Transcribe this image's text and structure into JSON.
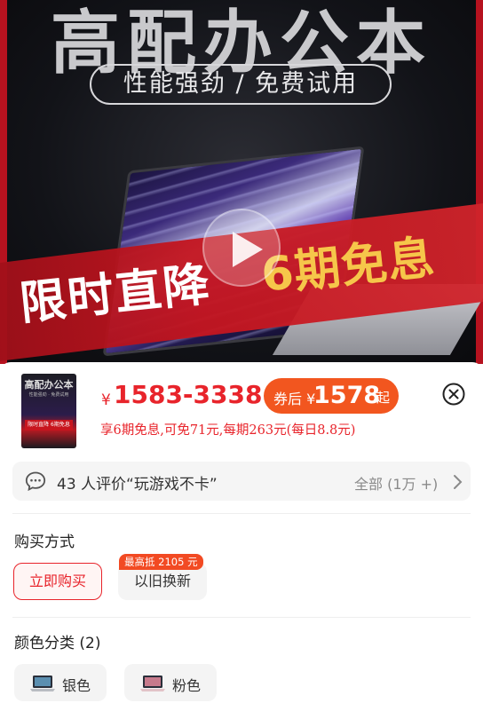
{
  "banner": {
    "title": "高配办公本",
    "subtitle": "性能强劲 / 免费试用",
    "promo_left": "限时直降",
    "promo_right": "6期免息",
    "play_icon": "play-icon"
  },
  "product": {
    "thumb_title": "高配办公本",
    "thumb_sub": "性能强劲 · 免费试用",
    "thumb_strip": "限时直降 6期免息",
    "currency": "¥",
    "price_range": "1583-3338",
    "coupon_prefix": "券后 ¥",
    "coupon_price": "1578",
    "coupon_suffix": "起",
    "installment": "享6期免息,可免71元,每期263元(每日8.8元)"
  },
  "review": {
    "text": "43 人评价“玩游戏不卡”",
    "all": "全部 (1万 +)"
  },
  "purchase": {
    "title": "购买方式",
    "options": [
      {
        "label": "立即购买",
        "selected": true
      },
      {
        "label": "以旧换新",
        "tag": "最高抵 2105 元"
      }
    ]
  },
  "colors": {
    "title": "颜色分类 (2)",
    "options": [
      {
        "label": "银色"
      },
      {
        "label": "粉色"
      }
    ]
  },
  "theme": {
    "accent": "#e8242b",
    "coupon": "#f2561f",
    "banner_red": "#c4151f",
    "gold": "#f6c64a"
  }
}
